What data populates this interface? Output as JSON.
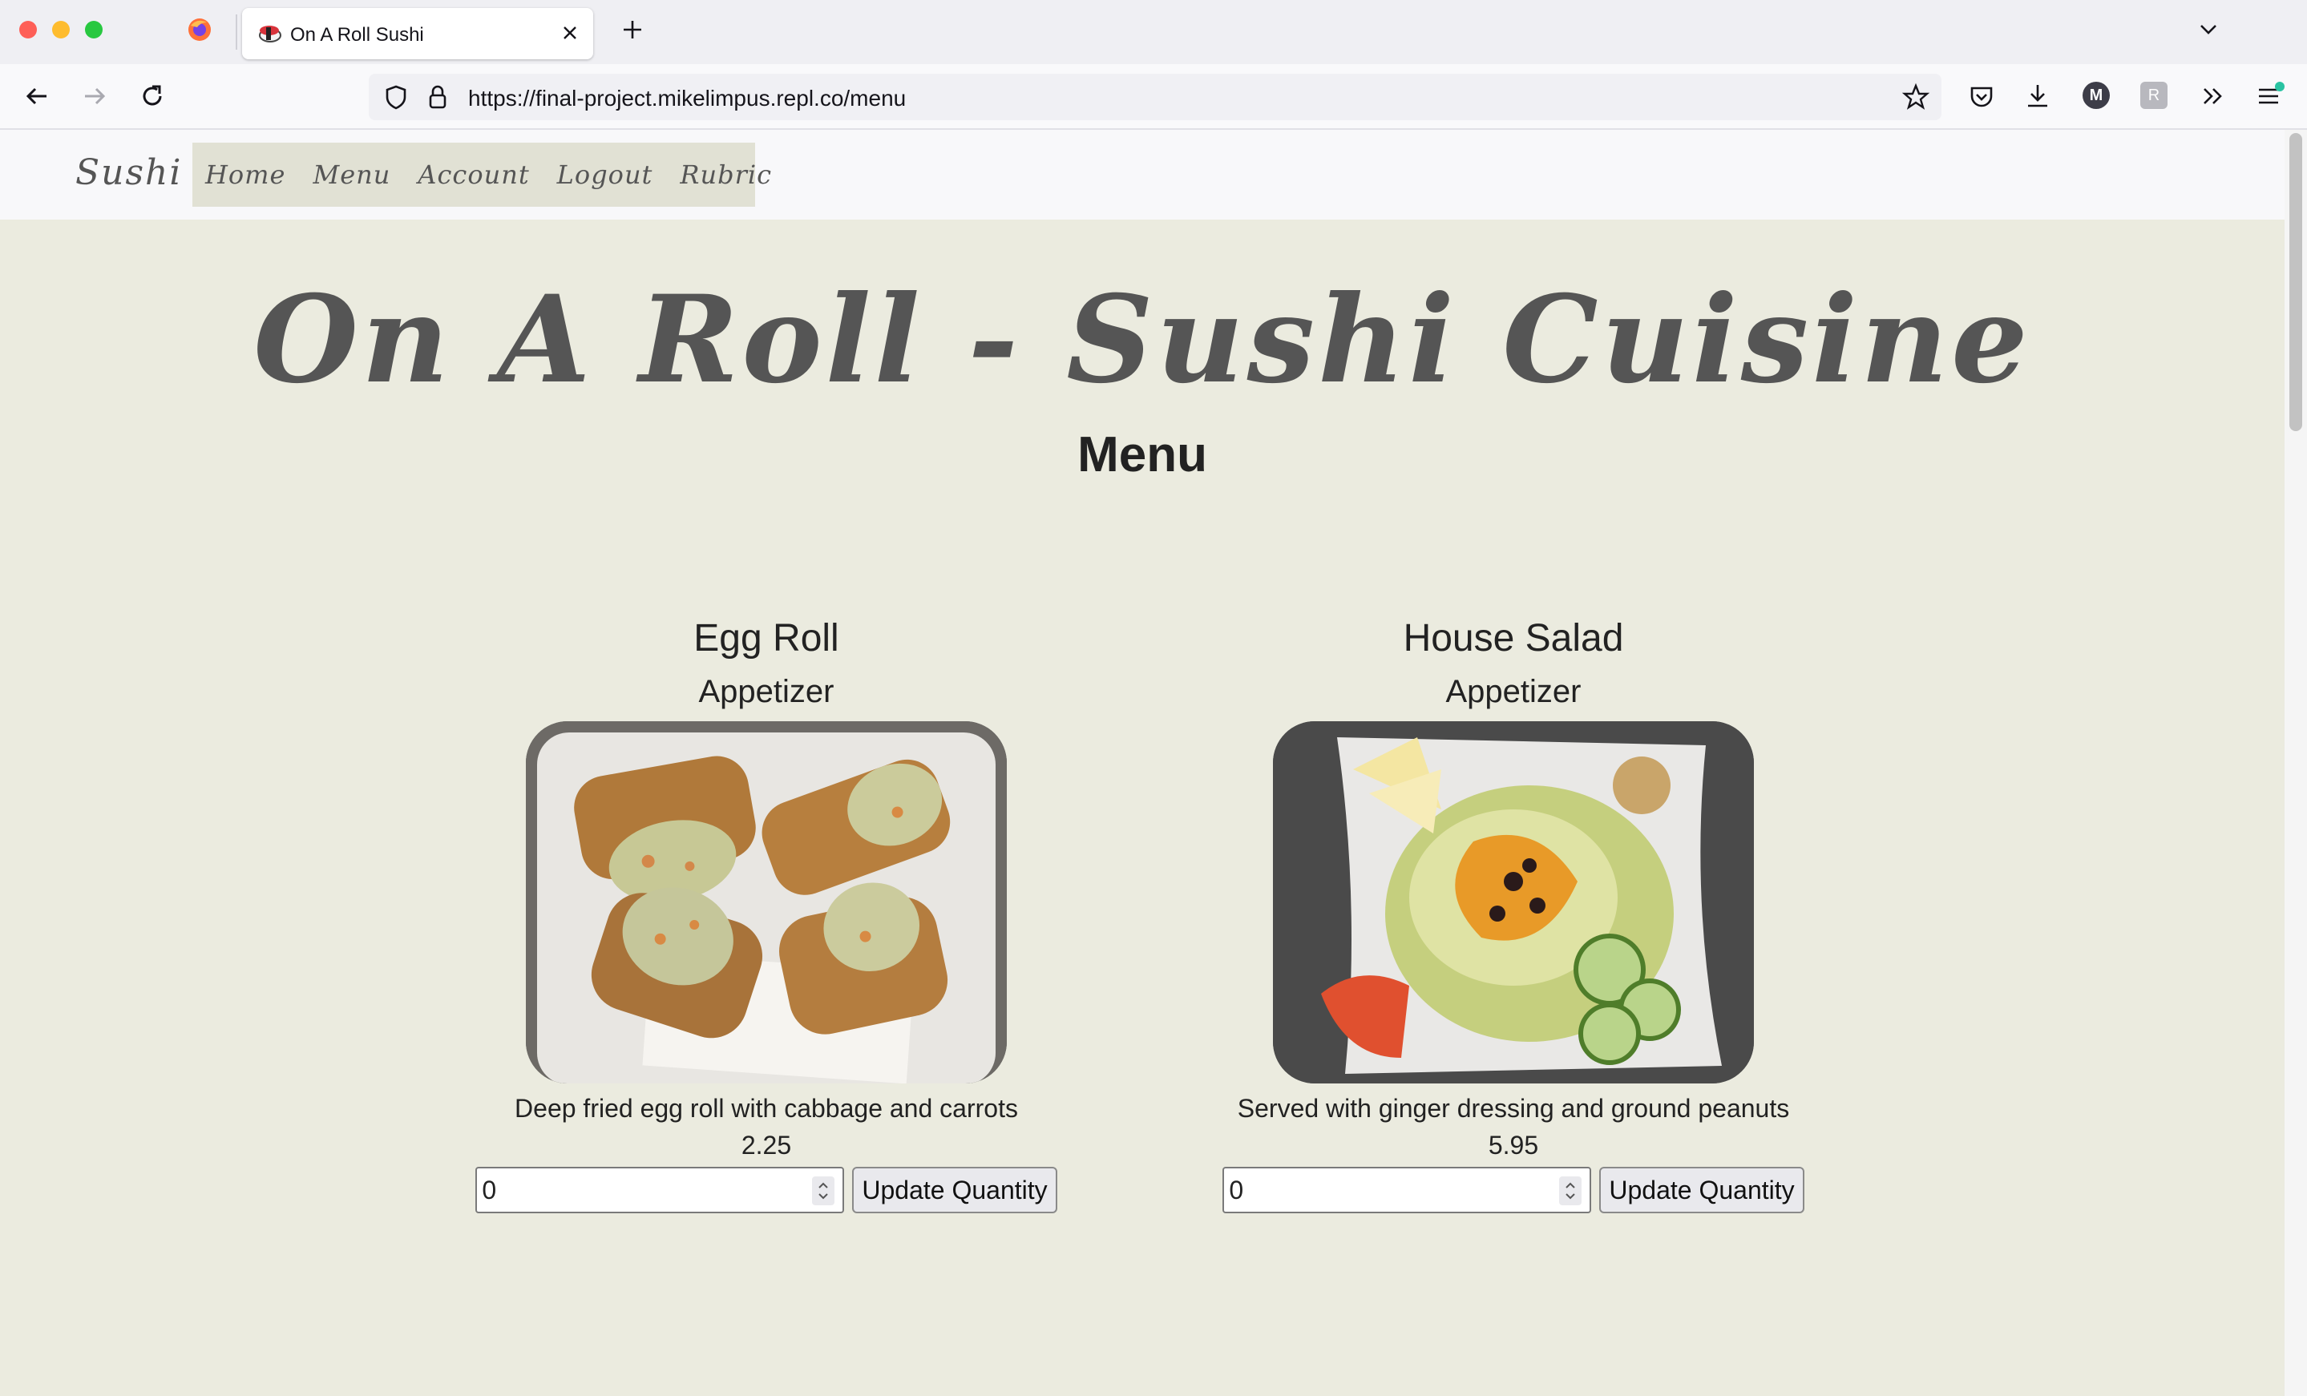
{
  "browser": {
    "tab_title": "On A Roll Sushi",
    "url": "https://final-project.mikelimpus.repl.co/menu",
    "profile_initial": "M",
    "extension_letter": "R",
    "accent_color": "#2ac3a2"
  },
  "site_nav": {
    "brand": "Sushi",
    "links": [
      "Home",
      "Menu",
      "Account",
      "Logout",
      "Rubric"
    ]
  },
  "page": {
    "title": "On A Roll - Sushi Cuisine",
    "heading": "Menu"
  },
  "menu_items": [
    {
      "name": "Egg Roll",
      "category": "Appetizer",
      "description": "Deep fried egg roll with cabbage and carrots",
      "price": "2.25",
      "quantity": "0",
      "button_label": "Update Quantity"
    },
    {
      "name": "House Salad",
      "category": "Appetizer",
      "description": "Served with ginger dressing and ground peanuts",
      "price": "5.95",
      "quantity": "0",
      "button_label": "Update Quantity"
    }
  ]
}
